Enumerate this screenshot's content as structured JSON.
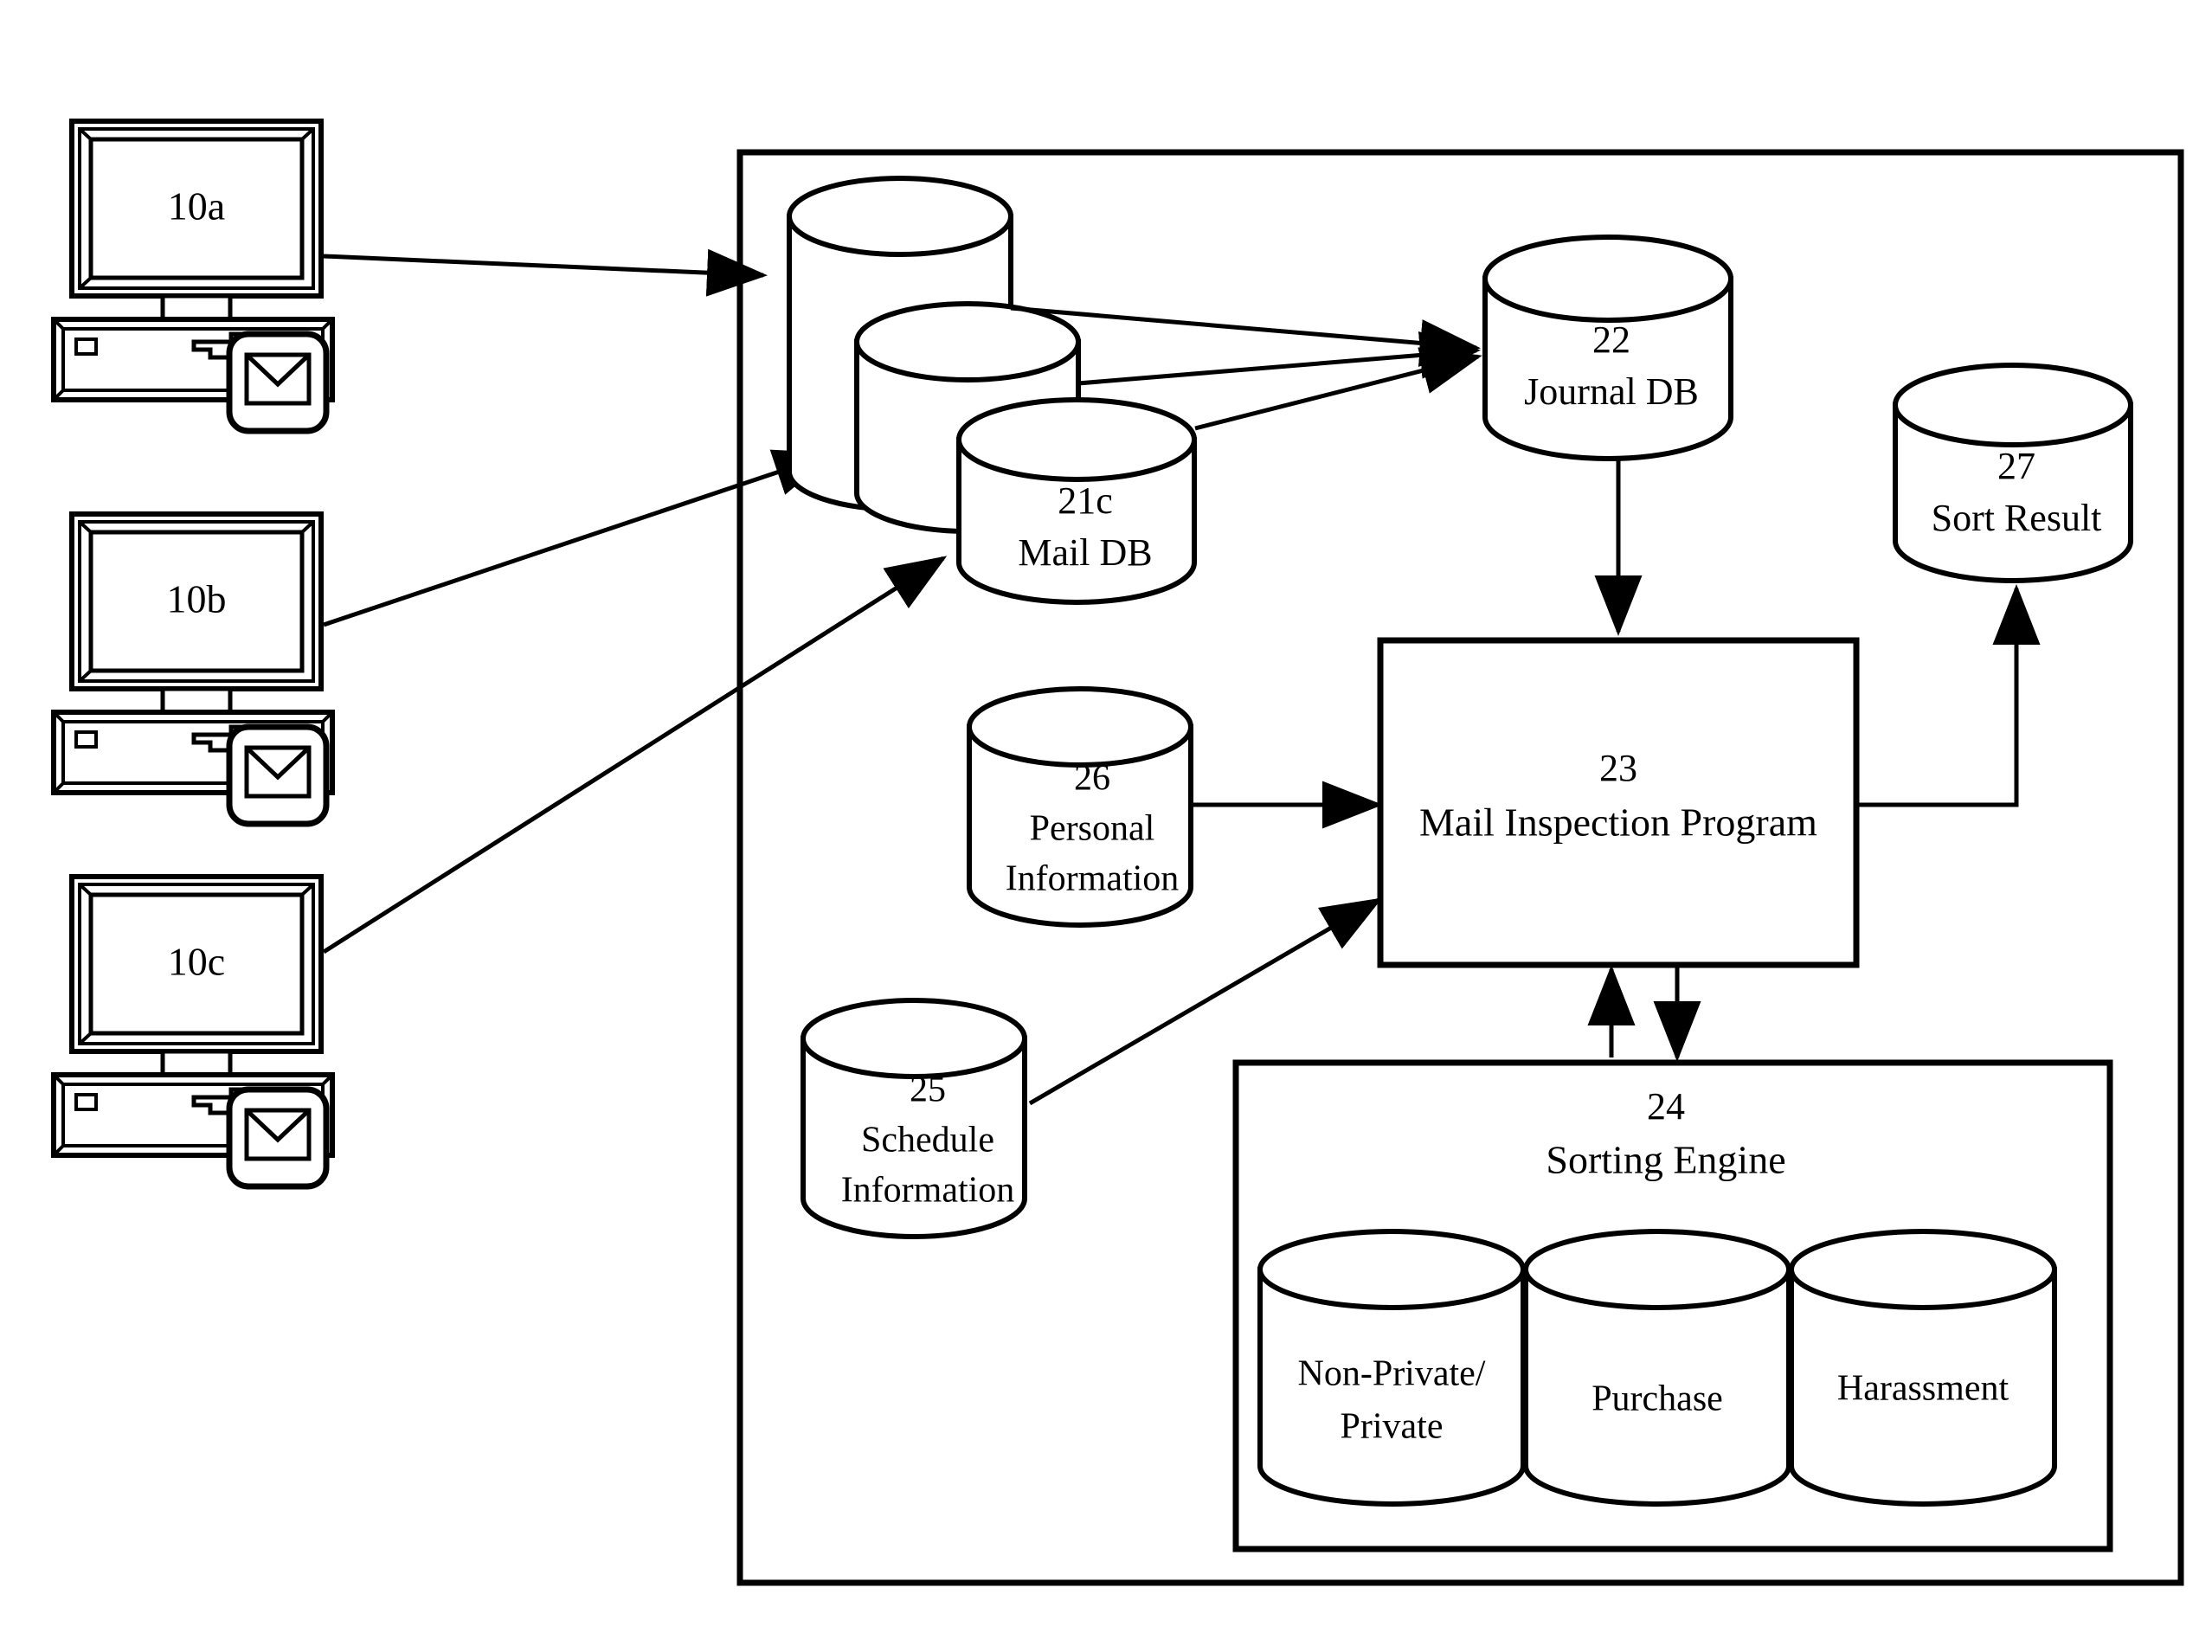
{
  "figure": {
    "type": "patent-system-block-diagram",
    "background_color": "#ffffff",
    "line_color": "#000000"
  },
  "terminals": [
    {
      "id": "t10a",
      "label": "10a",
      "icon": "desktop-computer-icon",
      "mail_icon": "envelope-icon"
    },
    {
      "id": "t10b",
      "label": "10b",
      "icon": "desktop-computer-icon",
      "mail_icon": "envelope-icon"
    },
    {
      "id": "t10c",
      "label": "10c",
      "icon": "desktop-computer-icon",
      "mail_icon": "envelope-icon"
    }
  ],
  "server": {
    "mail_dbs": [
      {
        "id": "db21a",
        "ref": "",
        "name": ""
      },
      {
        "id": "db21b",
        "ref": "",
        "name": ""
      },
      {
        "id": "db21c",
        "ref": "21c",
        "name": "Mail DB"
      }
    ],
    "journal_db": {
      "ref": "22",
      "name": "Journal DB"
    },
    "sort_result": {
      "ref": "27",
      "name": "Sort Result"
    },
    "personal_information": {
      "ref": "26",
      "name_line1": "Personal",
      "name_line2": "Information"
    },
    "schedule_information": {
      "ref": "25",
      "name_line1": "Schedule",
      "name_line2": "Information"
    },
    "inspection_program": {
      "ref": "23",
      "name": "Mail Inspection Program"
    },
    "sorting_engine": {
      "ref": "24",
      "name": "Sorting Engine",
      "buckets": [
        {
          "id": "b1",
          "line1": "Non-Private/",
          "line2": "Private"
        },
        {
          "id": "b2",
          "line1": "Purchase",
          "line2": ""
        },
        {
          "id": "b3",
          "line1": "Harassment",
          "line2": ""
        }
      ]
    }
  },
  "connections": [
    {
      "from": "10a",
      "to": "21a",
      "kind": "arrow"
    },
    {
      "from": "10b",
      "to": "21b",
      "kind": "arrow"
    },
    {
      "from": "10c",
      "to": "21c",
      "kind": "arrow"
    },
    {
      "from": "21a",
      "to": "22",
      "kind": "arrow"
    },
    {
      "from": "21b",
      "to": "22",
      "kind": "arrow"
    },
    {
      "from": "21c",
      "to": "22",
      "kind": "arrow"
    },
    {
      "from": "22",
      "to": "23",
      "kind": "arrow"
    },
    {
      "from": "26",
      "to": "23",
      "kind": "arrow"
    },
    {
      "from": "25",
      "to": "23",
      "kind": "arrow"
    },
    {
      "from": "23",
      "to": "27",
      "kind": "arrow"
    },
    {
      "from": "24",
      "to": "23",
      "kind": "arrow"
    },
    {
      "from": "23",
      "to": "24",
      "kind": "arrow"
    }
  ]
}
